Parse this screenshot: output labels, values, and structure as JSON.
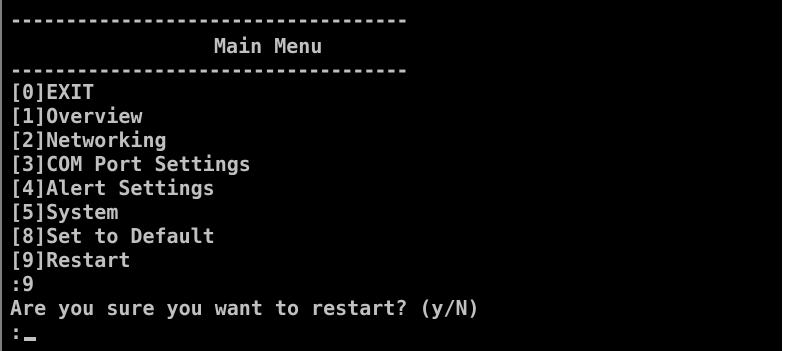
{
  "terminal": {
    "separator": "------------------------------------",
    "title": "Main Menu",
    "menu_items": [
      {
        "label": "[0]EXIT"
      },
      {
        "label": "[1]Overview"
      },
      {
        "label": "[2]Networking"
      },
      {
        "label": "[3]COM Port Settings"
      },
      {
        "label": "[4]Alert Settings"
      },
      {
        "label": "[5]System"
      },
      {
        "label": "[8]Set to Default"
      },
      {
        "label": "[9]Restart"
      }
    ],
    "input_echo": ":9",
    "confirm_prompt": "Are you sure you want to restart? (y/N)",
    "input_prompt": ":"
  },
  "colors": {
    "background": "#000000",
    "text": "#c0c0c0"
  }
}
